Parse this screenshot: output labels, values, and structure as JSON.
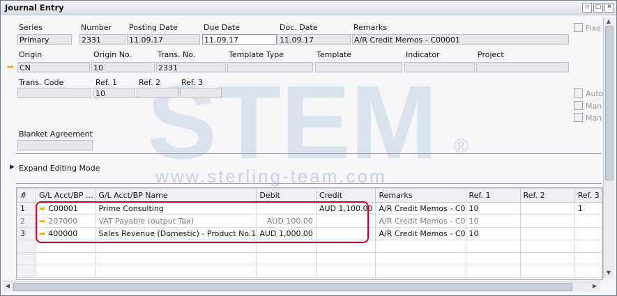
{
  "window": {
    "title": "Journal Entry",
    "buttons": [
      "▫",
      "▢",
      "✕"
    ]
  },
  "header": {
    "series": {
      "label": "Series",
      "value": "Primary"
    },
    "number": {
      "label": "Number",
      "value": "2331"
    },
    "posting_date": {
      "label": "Posting Date",
      "value": "11.09.17"
    },
    "due_date": {
      "label": "Due Date",
      "value": "11.09.17"
    },
    "doc_date": {
      "label": "Doc. Date",
      "value": "11.09.17"
    },
    "remarks": {
      "label": "Remarks",
      "value": "A/R Credit Memos - C00001"
    },
    "origin": {
      "label": "Origin",
      "value": "CN"
    },
    "origin_no": {
      "label": "Origin No.",
      "value": "10"
    },
    "trans_no": {
      "label": "Trans. No.",
      "value": "2331"
    },
    "template_type": {
      "label": "Template Type",
      "value": ""
    },
    "template": {
      "label": "Template",
      "value": ""
    },
    "indicator": {
      "label": "Indicator",
      "value": ""
    },
    "project": {
      "label": "Project",
      "value": ""
    },
    "trans_code": {
      "label": "Trans. Code",
      "value": ""
    },
    "ref1": {
      "label": "Ref. 1",
      "value": "10"
    },
    "ref2": {
      "label": "Ref. 2",
      "value": ""
    },
    "ref3": {
      "label": "Ref. 3",
      "value": ""
    },
    "blanket_agreement": {
      "label": "Blanket Agreement",
      "value": ""
    }
  },
  "side_checks": [
    "Fixe",
    "Auto",
    "Man",
    "Man"
  ],
  "expand_mode": "Expand Editing Mode",
  "watermark": {
    "logo": "STEM",
    "url": "www.sterling-team.com",
    "reg": "®"
  },
  "grid": {
    "columns": [
      "#",
      "G/L Acct/BP ...",
      "G/L Acct/BP Name",
      "Debit",
      "Credit",
      "Remarks",
      "Ref. 1",
      "Ref. 2",
      "Ref. 3"
    ],
    "rows": [
      {
        "no": "1",
        "acct": "C00001",
        "name": "Prime Consulting",
        "debit": "",
        "credit": "AUD 1,100.00",
        "remarks": "A/R Credit Memos - C0",
        "ref1": "10",
        "ref2": "",
        "ref3": "1"
      },
      {
        "no": "2",
        "acct": "207000",
        "name": "VAT Payable  (output Tax)",
        "debit": "AUD 100.00",
        "credit": "",
        "remarks": "A/R Credit Memos - C0",
        "ref1": "10",
        "ref2": "",
        "ref3": ""
      },
      {
        "no": "3",
        "acct": "400000",
        "name": "Sales Revenue (Domestic) - Product No.1",
        "debit": "AUD 1,000.00",
        "credit": "",
        "remarks": "A/R Credit Memos - C0",
        "ref1": "10",
        "ref2": "",
        "ref3": ""
      }
    ]
  }
}
